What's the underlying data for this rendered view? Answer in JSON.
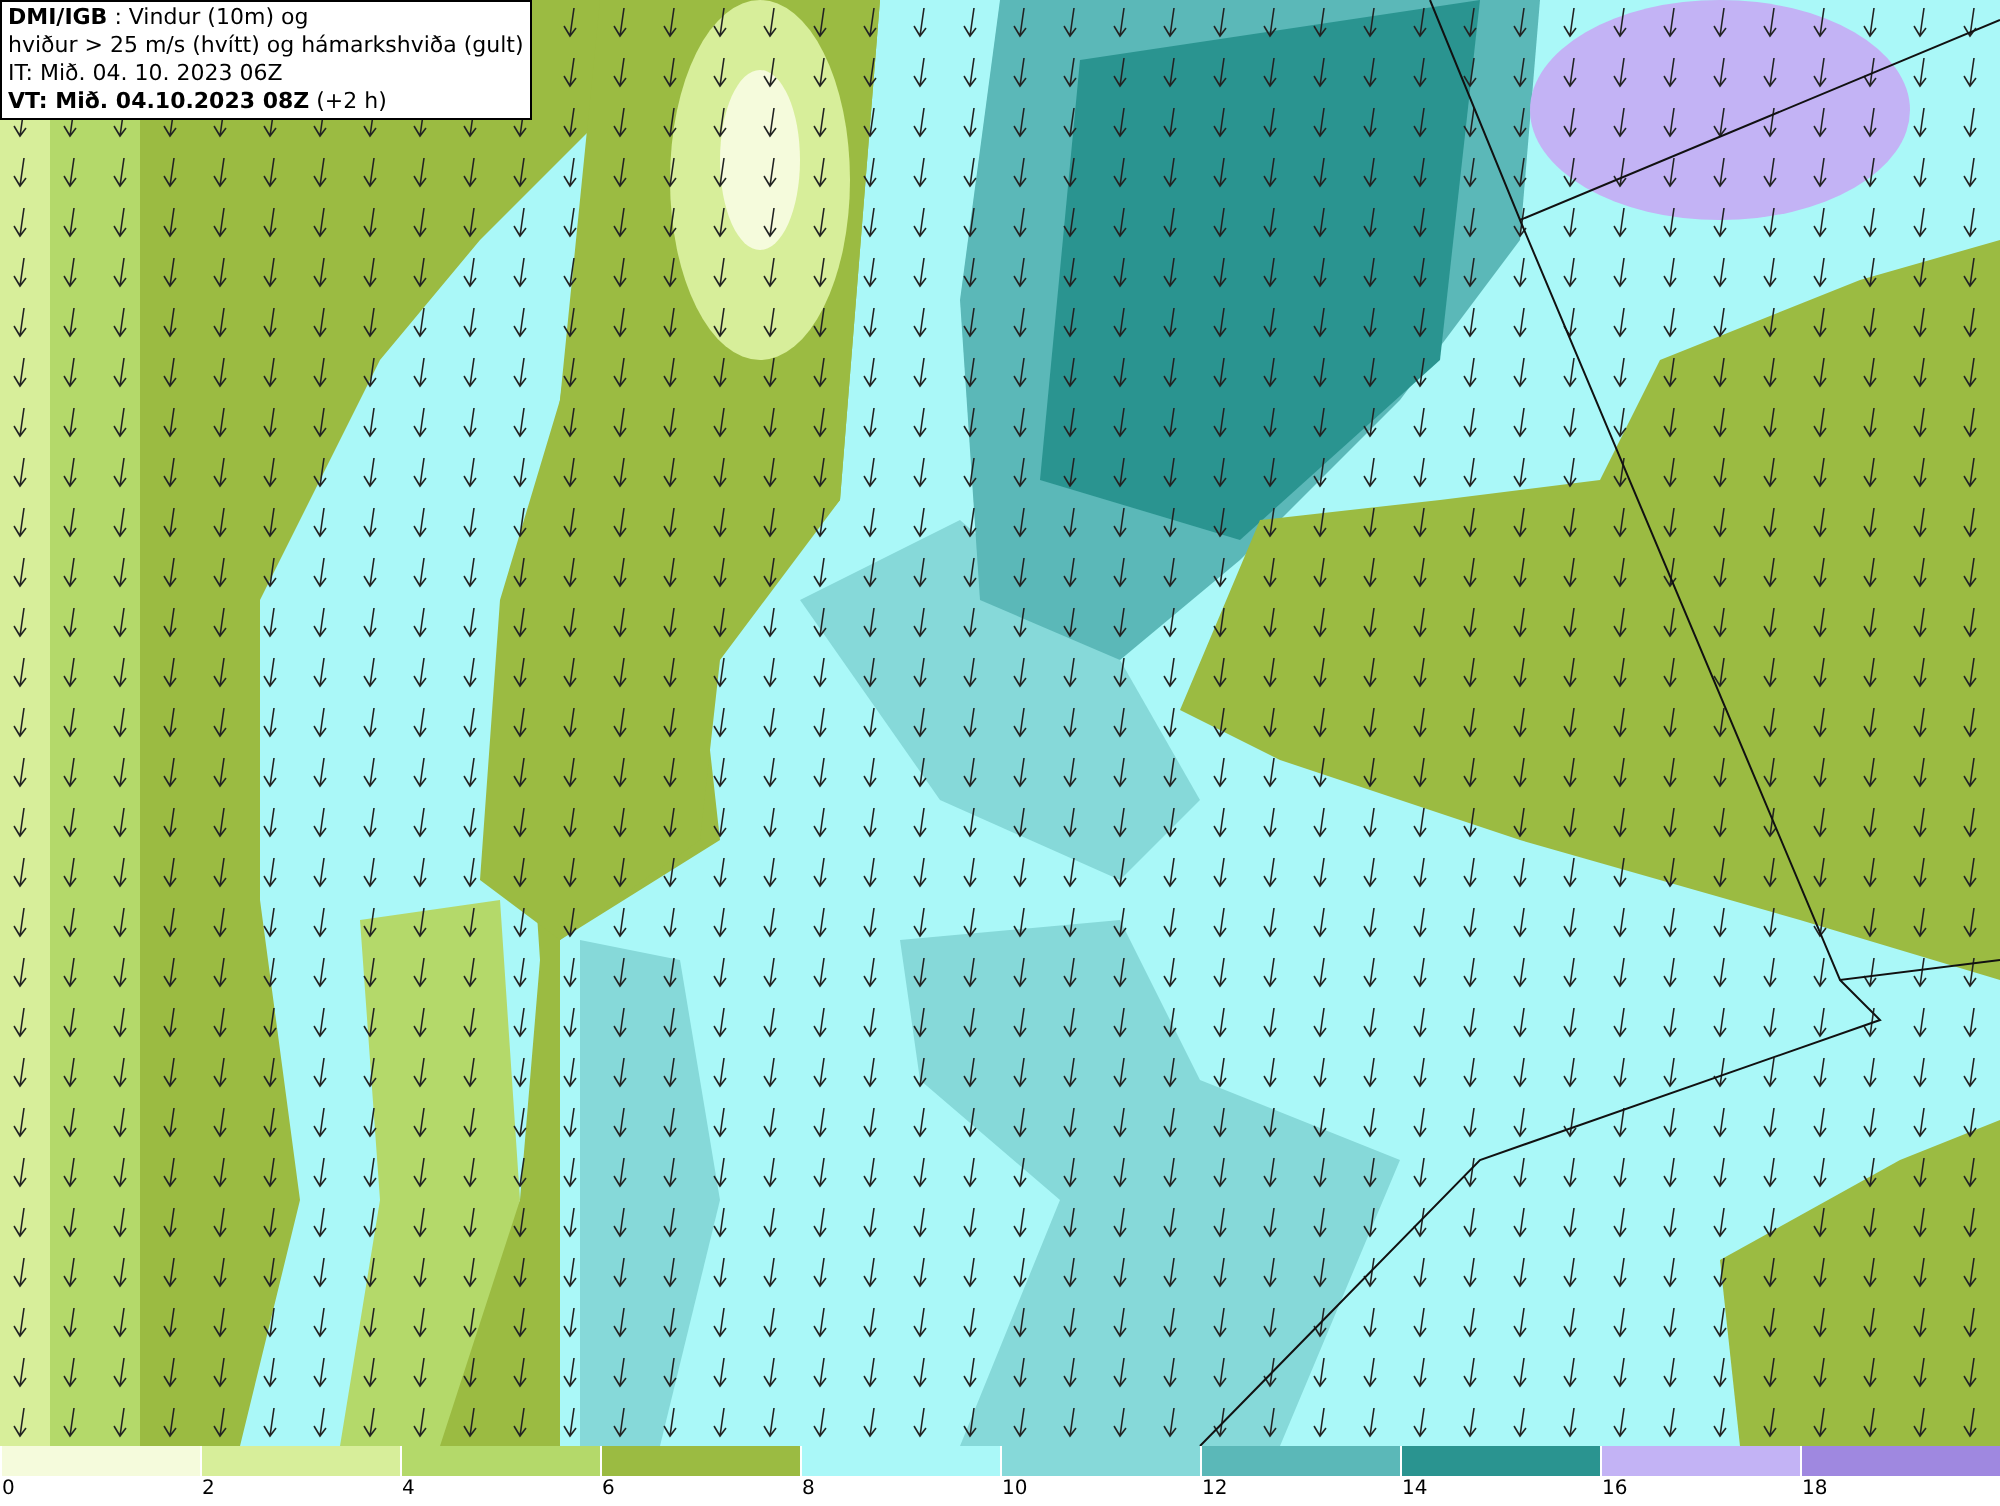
{
  "header": {
    "lines": [
      "**DMI/IGB** : Vindur (10m) og",
      "hviður > 25 m/s (hvítt) og hámarkshviða (gult)",
      "IT: Mið. 04. 10. 2023 06Z",
      "**VT: Mið. 04.10.2023 08Z** (+2 h)"
    ]
  },
  "legend": [
    {
      "label": "0",
      "color": "#f5fbdc"
    },
    {
      "label": "2",
      "color": "#d7ee9a"
    },
    {
      "label": "4",
      "color": "#b4d96a"
    },
    {
      "label": "6",
      "color": "#9bbb42"
    },
    {
      "label": "8",
      "color": "#aaf8f8"
    },
    {
      "label": "10",
      "color": "#86d9d9"
    },
    {
      "label": "12",
      "color": "#5bb8b8"
    },
    {
      "label": "14",
      "color": "#2a9490"
    },
    {
      "label": "16",
      "color": "#c3b3f5"
    },
    {
      "label": "18",
      "color": "#9f88e0"
    }
  ]
}
